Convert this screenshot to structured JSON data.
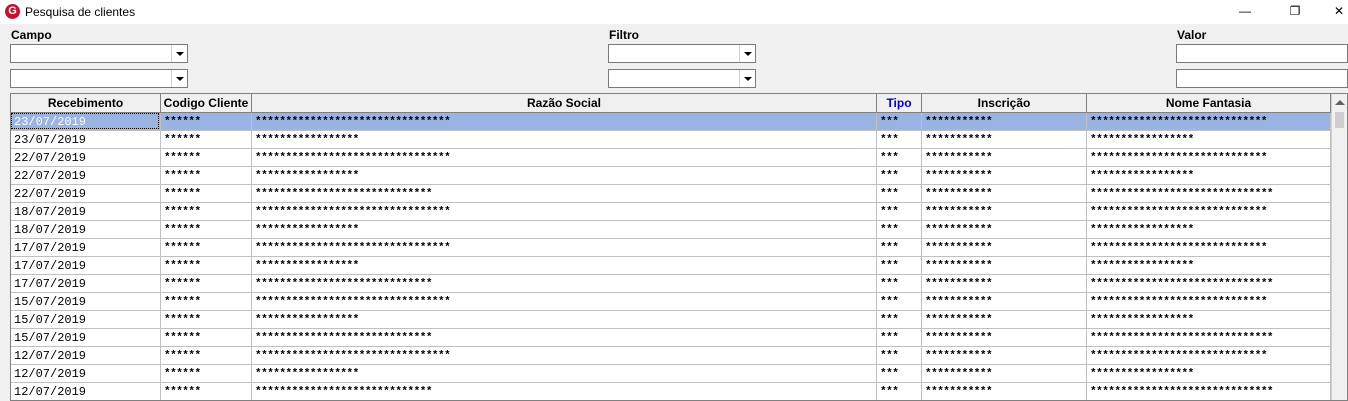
{
  "window": {
    "title": "Pesquisa de clientes",
    "minimize": "—",
    "maximize": "❐",
    "close": "✕"
  },
  "filters": {
    "campo_label": "Campo",
    "filtro_label": "Filtro",
    "valor_label": "Valor"
  },
  "columns": [
    "Recebimento",
    "Codigo Cliente",
    "Razão Social",
    "Tipo",
    "Inscrição",
    "Nome Fantasia"
  ],
  "rows": [
    [
      "23/07/2019",
      "******",
      "********************************",
      "***",
      "***********",
      "*****************************"
    ],
    [
      "23/07/2019",
      "******",
      "*****************",
      "***",
      "***********",
      "*****************"
    ],
    [
      "22/07/2019",
      "******",
      "********************************",
      "***",
      "***********",
      "*****************************"
    ],
    [
      "22/07/2019",
      "******",
      "*****************",
      "***",
      "***********",
      "*****************"
    ],
    [
      "22/07/2019",
      "******",
      "*****************************",
      "***",
      "***********",
      "******************************"
    ],
    [
      "18/07/2019",
      "******",
      "********************************",
      "***",
      "***********",
      "*****************************"
    ],
    [
      "18/07/2019",
      "******",
      "*****************",
      "***",
      "***********",
      "*****************"
    ],
    [
      "17/07/2019",
      "******",
      "********************************",
      "***",
      "***********",
      "*****************************"
    ],
    [
      "17/07/2019",
      "******",
      "*****************",
      "***",
      "***********",
      "*****************"
    ],
    [
      "17/07/2019",
      "******",
      "*****************************",
      "***",
      "***********",
      "******************************"
    ],
    [
      "15/07/2019",
      "******",
      "********************************",
      "***",
      "***********",
      "*****************************"
    ],
    [
      "15/07/2019",
      "******",
      "*****************",
      "***",
      "***********",
      "*****************"
    ],
    [
      "15/07/2019",
      "******",
      "*****************************",
      "***",
      "***********",
      "******************************"
    ],
    [
      "12/07/2019",
      "******",
      "********************************",
      "***",
      "***********",
      "*****************************"
    ],
    [
      "12/07/2019",
      "******",
      "*****************",
      "***",
      "***********",
      "*****************"
    ],
    [
      "12/07/2019",
      "******",
      "*****************************",
      "***",
      "***********",
      "******************************"
    ]
  ],
  "colors": {
    "selected_row": "#99b4e3",
    "tipo_header": "#0000cc",
    "logo": "#c8102e"
  },
  "icons": {
    "logo": "app-logo-icon",
    "dropdown": "chevron-down-icon"
  }
}
